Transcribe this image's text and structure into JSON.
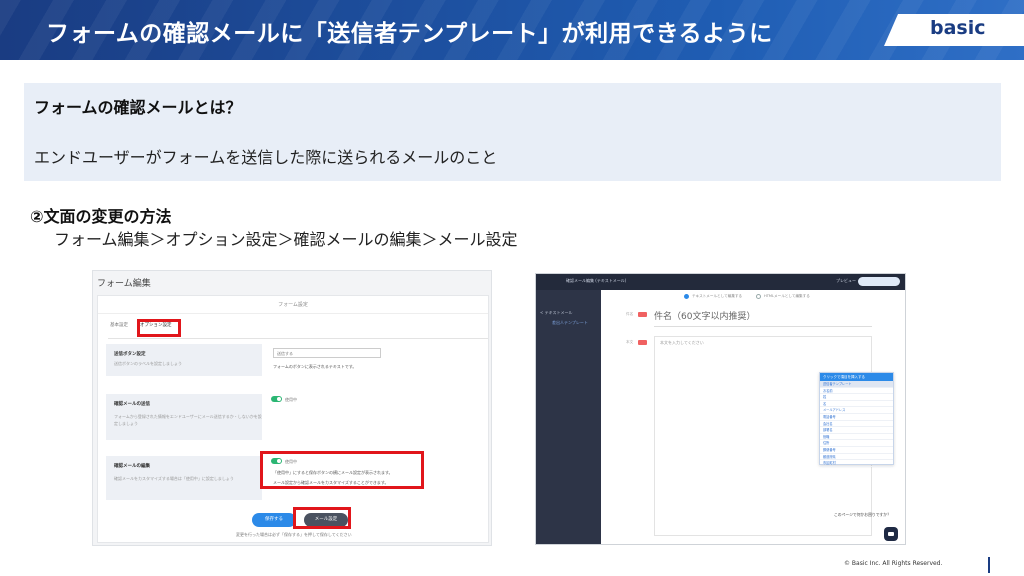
{
  "header": {
    "title": "フォームの確認メールに「送信者テンプレート」が利用できるように",
    "brand": "basic"
  },
  "info": {
    "question": "フォームの確認メールとは？",
    "answer": "エンドユーザーがフォームを送信した際に送られるメールのこと"
  },
  "method": {
    "title": "②文面の変更の方法",
    "path": "フォーム編集＞オプション設定＞確認メールの編集＞メール設定"
  },
  "left_screenshot": {
    "title": "フォーム編集",
    "panel_header": "フォーム設定",
    "tabs": [
      "基本設定",
      "オプション設定"
    ],
    "rows": [
      {
        "title": "送信ボタン設定",
        "desc": "送信ボタンのラベルを設定しましょう"
      },
      {
        "title": "確認メールの送信",
        "desc": "フォームから登録された情報をエンドユーザーにメール送信するか・しないかを設定しましょう"
      },
      {
        "title": "確認メールの編集",
        "desc": "確認メールをカスタマイズする場合は「使用中」に設定しましょう"
      }
    ],
    "input_value": "送信する",
    "input_note": "フォームのボタンに表示されるテキストです。",
    "toggle_label": "使用中",
    "edit_note_1": "「使用中」にすると保存ボタンの横にメール設定が表示されます。",
    "edit_note_2": "メール設定から確認メールをカスタマイズすることができます。",
    "save_button": "保存する",
    "mail_button": "メール設定",
    "footer_note": "変更を行った場合は必ず「保存する」を押して保存してください"
  },
  "right_screenshot": {
    "top_title": "確認メール編集 (テキストメール)",
    "preview": "プレビュー",
    "back": "< テキストメール",
    "sidebar_item": "差出人テンプレート",
    "radio_text": "テキストメールとして編集する",
    "radio_html": "HTMLメールとして編集する",
    "subject_label": "件名",
    "subject_placeholder": "件名（60文字以内推奨）",
    "body_label": "本文",
    "body_placeholder": "本文を入力してください",
    "dropdown_title": "クリックで項目を挿入する",
    "dropdown_items": [
      "送信者テンプレート",
      "お名前",
      "姓",
      "名",
      "メールアドレス",
      "電話番号",
      "会社名",
      "部署名",
      "役職",
      "住所",
      "郵便番号",
      "都道府県",
      "市区町村",
      "番地",
      "お問い合わせ内容"
    ],
    "chat_question": "このページで何かお困りですか？"
  },
  "footer": {
    "copyright": "© Basic Inc. All Rights Reserved."
  }
}
